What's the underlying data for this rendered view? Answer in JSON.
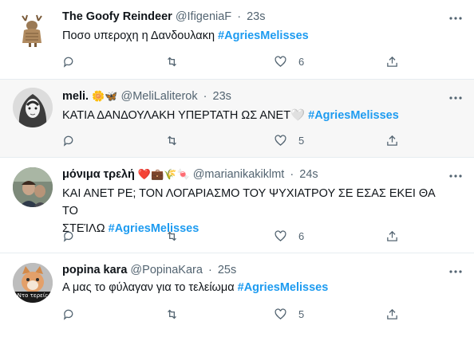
{
  "tweets": [
    {
      "name": "The Goofy Reindeer",
      "handle": "@IfigeniaF",
      "time": "23s",
      "emojis": "",
      "text": "Ποσο υπεροχη η Δανδουλακη ",
      "hashtag": "#AgriesMelisses",
      "text_line2": "",
      "likes": "6"
    },
    {
      "name": "meli.",
      "handle": "@MeliLaliterok",
      "time": "23s",
      "emojis": "🌼🦋",
      "text": "ΚΑΤΙΑ ΔΑΝΔΟΥΛΑΚΗ ΥΠΕΡΤΑΤΗ ΩΣ ΑΝΕΤ🤍 ",
      "hashtag": "#AgriesMelisses",
      "text_line2": "",
      "likes": "5"
    },
    {
      "name": "μόνιμα τρελή",
      "handle": "@marianikakiklmt",
      "time": "24s",
      "emojis": "❤️💼🌾🍬",
      "text": "ΚΑΙ ΑΝΕΤ ΡΕ; ΤΟΝ ΛΟΓΑΡΙΑΣΜΟ ΤΟΥ ΨΥΧΙΑΤΡΟΥ ΣΕ ΕΣΑΣ ΕΚΕΙ ΘΑ ΤΟ",
      "text_line2": "ΣΤΕΊΛΩ ",
      "hashtag": "#AgriesMelisses",
      "likes": "6"
    },
    {
      "name": "popina kara",
      "handle": "@PopinaKara",
      "time": "25s",
      "emojis": "",
      "text": "Α μας το φύλαγαν για το τελείωμα ",
      "hashtag": "#AgriesMelisses",
      "text_line2": "",
      "likes": "5",
      "avatar_caption": "Ντο τερείς"
    }
  ],
  "separator": "·",
  "colors": {
    "accent": "#1d9bf0",
    "muted": "#536471",
    "border": "#e6ecf0",
    "highlight_bg": "#f7f7f7"
  },
  "icons": [
    "reply-icon",
    "retweet-icon",
    "like-icon",
    "share-icon",
    "more-icon"
  ]
}
